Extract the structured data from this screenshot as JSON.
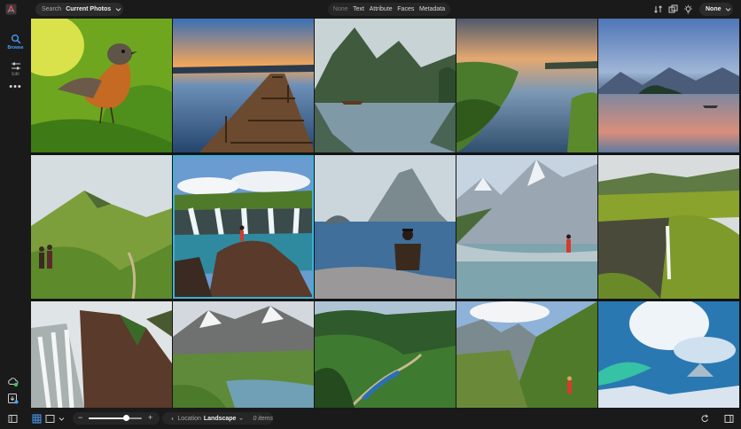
{
  "topbar": {
    "search_label": "Search",
    "search_value": "Current Photos",
    "filter_tabs": [
      "None",
      "Text",
      "Attribute",
      "Faces",
      "Metadata"
    ],
    "sort_value": "None"
  },
  "rail": {
    "browse_label": "Browse",
    "edit_label": "Edit",
    "more_label": "•••"
  },
  "bottombar": {
    "zoom_level": 0.7,
    "zoom_minus": "−",
    "zoom_plus": "+",
    "location_label": "Location",
    "location_value": "Landscape",
    "item_count": "0 items"
  },
  "colors": {
    "accent": "#4aa3ff",
    "selection": "#3ab3d6"
  },
  "photos": [
    "bird",
    "pier",
    "boat-lake",
    "coastal-lake",
    "island-lake",
    "hikers-ridge",
    "waterfall-hiker",
    "sea-rock-sitter",
    "mountain-lake-hiker",
    "cliff-waterfall",
    "waterfall-canyon",
    "snow-mountain-lake",
    "forest-train",
    "hiker-valley",
    "aurora-sky"
  ]
}
